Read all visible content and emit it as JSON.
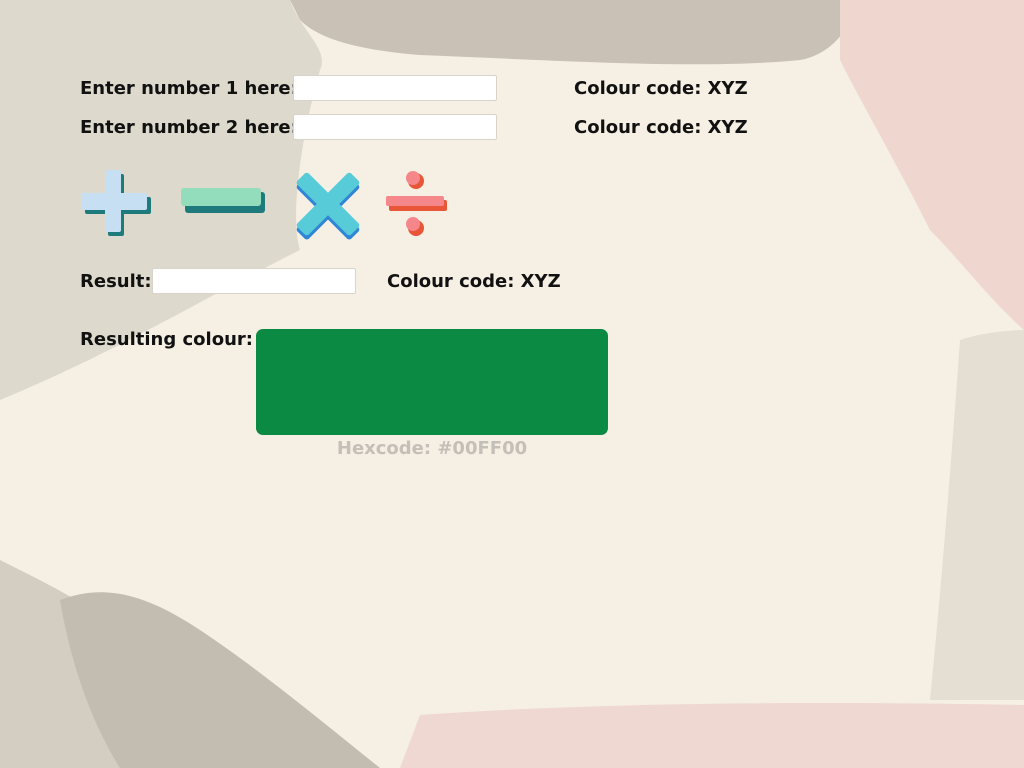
{
  "number1": {
    "label": "Enter number 1 here:",
    "value": "",
    "colour_code": "Colour code: XYZ"
  },
  "number2": {
    "label": "Enter number 2 here:",
    "value": "",
    "colour_code": "Colour code: XYZ"
  },
  "operations": [
    {
      "name": "plus",
      "icon": "plus-icon",
      "colors": [
        "#c7dff2",
        "#1f7b7b"
      ]
    },
    {
      "name": "minus",
      "icon": "minus-icon",
      "colors": [
        "#93dcbc",
        "#1f7b7b"
      ]
    },
    {
      "name": "multiply",
      "icon": "multiply-icon",
      "colors": [
        "#58cbd8",
        "#2f86d6"
      ]
    },
    {
      "name": "divide",
      "icon": "divide-icon",
      "colors": [
        "#f5878a",
        "#e85637"
      ]
    }
  ],
  "result": {
    "label": "Result:",
    "value": "",
    "colour_code": "Colour code: XYZ"
  },
  "resulting_colour": {
    "label": "Resulting colour:",
    "swatch_color": "#0b8a44",
    "hexcode": "Hexcode: #00FF00"
  }
}
